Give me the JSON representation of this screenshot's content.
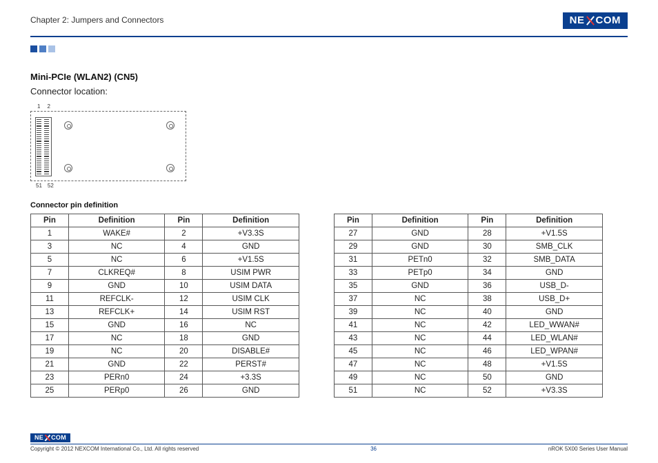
{
  "header": {
    "chapter": "Chapter 2: Jumpers and Connectors",
    "brand_left": "NE",
    "brand_right": "COM"
  },
  "section": {
    "title": "Mini-PCIe (WLAN2) (CN5)",
    "subtitle": "Connector location:",
    "diag_top_1": "1",
    "diag_top_2": "2",
    "diag_bot_51": "51",
    "diag_bot_52": "52",
    "table_caption": "Connector pin definition",
    "th_pin": "Pin",
    "th_def": "Definition"
  },
  "table_left": [
    {
      "p1": "1",
      "d1": "WAKE#",
      "p2": "2",
      "d2": "+V3.3S"
    },
    {
      "p1": "3",
      "d1": "NC",
      "p2": "4",
      "d2": "GND"
    },
    {
      "p1": "5",
      "d1": "NC",
      "p2": "6",
      "d2": "+V1.5S"
    },
    {
      "p1": "7",
      "d1": "CLKREQ#",
      "p2": "8",
      "d2": "USIM PWR"
    },
    {
      "p1": "9",
      "d1": "GND",
      "p2": "10",
      "d2": "USIM DATA"
    },
    {
      "p1": "11",
      "d1": "REFCLK-",
      "p2": "12",
      "d2": "USIM CLK"
    },
    {
      "p1": "13",
      "d1": "REFCLK+",
      "p2": "14",
      "d2": "USIM RST"
    },
    {
      "p1": "15",
      "d1": "GND",
      "p2": "16",
      "d2": "NC"
    },
    {
      "p1": "17",
      "d1": "NC",
      "p2": "18",
      "d2": "GND"
    },
    {
      "p1": "19",
      "d1": "NC",
      "p2": "20",
      "d2": "DISABLE#"
    },
    {
      "p1": "21",
      "d1": "GND",
      "p2": "22",
      "d2": "PERST#"
    },
    {
      "p1": "23",
      "d1": "PERn0",
      "p2": "24",
      "d2": "+3.3S"
    },
    {
      "p1": "25",
      "d1": "PERp0",
      "p2": "26",
      "d2": "GND"
    }
  ],
  "table_right": [
    {
      "p1": "27",
      "d1": "GND",
      "p2": "28",
      "d2": "+V1.5S"
    },
    {
      "p1": "29",
      "d1": "GND",
      "p2": "30",
      "d2": "SMB_CLK"
    },
    {
      "p1": "31",
      "d1": "PETn0",
      "p2": "32",
      "d2": "SMB_DATA"
    },
    {
      "p1": "33",
      "d1": "PETp0",
      "p2": "34",
      "d2": "GND"
    },
    {
      "p1": "35",
      "d1": "GND",
      "p2": "36",
      "d2": "USB_D-"
    },
    {
      "p1": "37",
      "d1": "NC",
      "p2": "38",
      "d2": "USB_D+"
    },
    {
      "p1": "39",
      "d1": "NC",
      "p2": "40",
      "d2": "GND"
    },
    {
      "p1": "41",
      "d1": "NC",
      "p2": "42",
      "d2": "LED_WWAN#"
    },
    {
      "p1": "43",
      "d1": "NC",
      "p2": "44",
      "d2": "LED_WLAN#"
    },
    {
      "p1": "45",
      "d1": "NC",
      "p2": "46",
      "d2": "LED_WPAN#"
    },
    {
      "p1": "47",
      "d1": "NC",
      "p2": "48",
      "d2": "+V1.5S"
    },
    {
      "p1": "49",
      "d1": "NC",
      "p2": "50",
      "d2": "GND"
    },
    {
      "p1": "51",
      "d1": "NC",
      "p2": "52",
      "d2": "+V3.3S"
    }
  ],
  "footer": {
    "copyright": "Copyright © 2012 NEXCOM International Co., Ltd. All rights reserved",
    "page": "36",
    "manual": "nROK 5X00 Series User Manual"
  }
}
